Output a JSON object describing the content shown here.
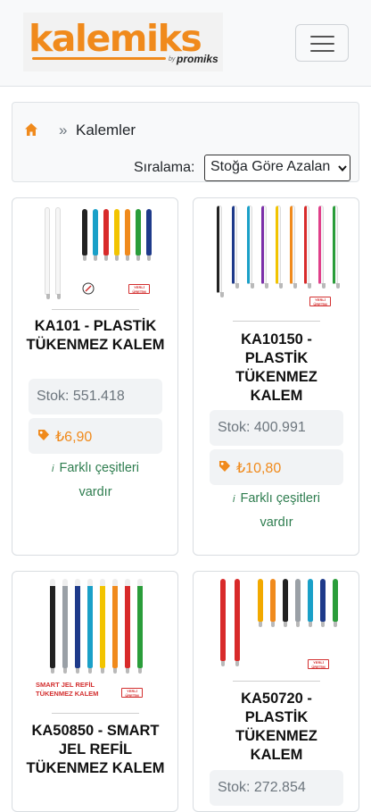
{
  "header": {
    "logo_text": "kalemiks",
    "logo_by": "by",
    "logo_sub": "promiks",
    "menu_icon": "hamburger-icon"
  },
  "breadcrumb": {
    "home_icon": "home-icon",
    "separator": "»",
    "current": "Kalemler"
  },
  "sort": {
    "label": "Sıralama:",
    "selected": "Stoğa Göre Azalan"
  },
  "colors": {
    "accent": "#f08a1c",
    "variant_text": "#2e7d4f",
    "badge_red": "#d32f2f"
  },
  "products": [
    {
      "name": "KA101 - PLASTİK TÜKENMEZ KALEM",
      "stock": "Stok: 551.418",
      "price": "₺6,90",
      "variants": "Farklı çeşitleri vardır",
      "badge": "YERLİ ÜRETİM"
    },
    {
      "name": "KA10150 - PLASTİK TÜKENMEZ KALEM",
      "stock": "Stok: 400.991",
      "price": "₺10,80",
      "variants": "Farklı çeşitleri vardır",
      "badge": "YERLİ ÜRETİM"
    },
    {
      "name": "KA50850 - SMART JEL REFİL TÜKENMEZ KALEM",
      "image_caption": "SMART JEL REFİL TÜKENMEZ KALEM",
      "badge": "YERLİ ÜRETİM"
    },
    {
      "name": "KA50720 - PLASTİK TÜKENMEZ KALEM",
      "stock": "Stok: 272.854",
      "badge": "YERLİ ÜRETİM"
    }
  ]
}
